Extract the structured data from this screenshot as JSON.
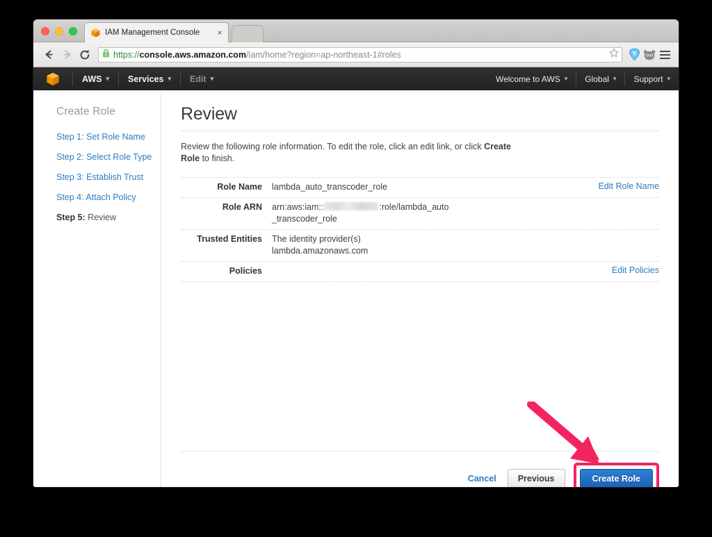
{
  "window": {
    "traffic_lights": [
      "close",
      "minimize",
      "maximize"
    ],
    "tab": {
      "title": "IAM Management Console",
      "favicon": "aws-cube-icon",
      "close_label": "×"
    },
    "new_tab_label": ""
  },
  "toolbar": {
    "back_label": "←",
    "forward_label": "→",
    "reload_label": "⟳",
    "url": {
      "scheme": "https://",
      "host": "console.aws.amazon.com",
      "path": "/iam/home?region=ap-northeast-1#roles",
      "full": "https://console.aws.amazon.com/iam/home?region=ap-northeast-1#roles",
      "lock_icon": "padlock-icon",
      "secure": true
    },
    "bookmark_icon": "star-icon",
    "extensions": [
      "ystar-extension-icon",
      "panda-extension-icon"
    ],
    "menu_icon": "hamburger-menu-icon"
  },
  "aws_navbar": {
    "logo": "aws-cube-logo",
    "left_items": [
      {
        "label": "AWS",
        "caret": "▾",
        "muted": false
      },
      {
        "label": "Services",
        "caret": "▾",
        "muted": false
      },
      {
        "label": "Edit",
        "caret": "▾",
        "muted": true
      }
    ],
    "right_items": [
      {
        "label": "Welcome to AWS",
        "caret": "▾"
      },
      {
        "label": "Global",
        "caret": "▾"
      },
      {
        "label": "Support",
        "caret": "▾"
      }
    ]
  },
  "sidebar": {
    "title": "Create Role",
    "steps": [
      {
        "num": "Step 1:",
        "label": " Set Role Name",
        "current": false
      },
      {
        "num": "Step 2:",
        "label": " Select Role Type",
        "current": false
      },
      {
        "num": "Step 3:",
        "label": " Establish Trust",
        "current": false
      },
      {
        "num": "Step 4:",
        "label": " Attach Policy",
        "current": false
      },
      {
        "num": "Step 5:",
        "label": " Review",
        "current": true
      }
    ]
  },
  "main": {
    "title": "Review",
    "intro_before": "Review the following role information. To edit the role, click an edit link, or click ",
    "intro_bold": "Create Role",
    "intro_after": " to finish.",
    "rows": [
      {
        "label": "Role Name",
        "value": "lambda_auto_transcoder_role",
        "value_line2": "",
        "redacted": false,
        "action": "Edit Role Name"
      },
      {
        "label": "Role ARN",
        "value": "arn:aws:iam::",
        "value_suffix": ":role/lambda_auto",
        "value_line2": "_transcoder_role",
        "redacted": true,
        "action": ""
      },
      {
        "label": "Trusted Entities",
        "value": "The identity provider(s)",
        "value_line2": "lambda.amazonaws.com",
        "redacted": false,
        "action": ""
      },
      {
        "label": "Policies",
        "value": "",
        "value_line2": "",
        "redacted": false,
        "action": "Edit Policies"
      }
    ]
  },
  "footer": {
    "cancel_label": "Cancel",
    "previous_label": "Previous",
    "create_label": "Create Role"
  },
  "annotation": {
    "arrow_color": "#f3245f",
    "highlight_color": "#f3245f",
    "arrow_target": "create-role-button"
  },
  "colors": {
    "aws_navbar_bg": "#262626",
    "aws_orange": "#f29100",
    "link_blue": "#2e7bbf",
    "primary_button_blue": "#1f6dc4",
    "annotation_pink": "#f3245f"
  }
}
